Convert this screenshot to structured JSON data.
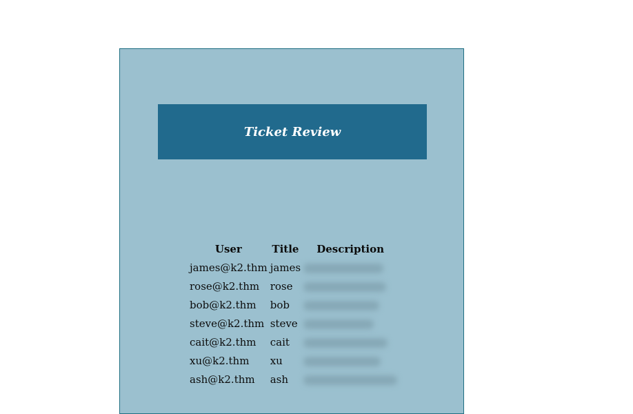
{
  "banner": {
    "title": "Ticket Review"
  },
  "table": {
    "headers": {
      "user": "User",
      "title": "Title",
      "description": "Description"
    },
    "rows": [
      {
        "user": "james@k2.thm",
        "title": "james"
      },
      {
        "user": "rose@k2.thm",
        "title": "rose"
      },
      {
        "user": "bob@k2.thm",
        "title": "bob"
      },
      {
        "user": "steve@k2.thm",
        "title": "steve"
      },
      {
        "user": "cait@k2.thm",
        "title": "cait"
      },
      {
        "user": "xu@k2.thm",
        "title": "xu"
      },
      {
        "user": "ash@k2.thm",
        "title": "ash"
      }
    ]
  },
  "colors": {
    "page_background": "#ffffff",
    "panel_background": "#9bc0cf",
    "banner_background": "#216a8d",
    "banner_text": "#ffffff"
  }
}
